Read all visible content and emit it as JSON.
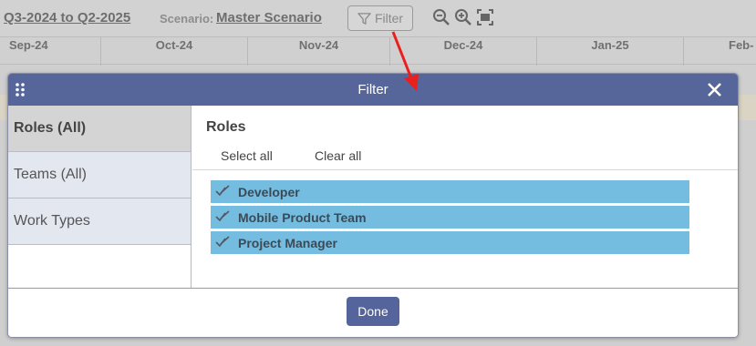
{
  "toolbar": {
    "period": "Q3-2024 to Q2-2025",
    "scenario_label": "Scenario:",
    "scenario_value": "Master Scenario",
    "filter_label": "Filter",
    "icons": [
      "filter-icon",
      "zoom-out-icon",
      "zoom-in-icon",
      "fit-screen-icon"
    ]
  },
  "timeline": {
    "months": [
      "Sep-24",
      "Oct-24",
      "Nov-24",
      "Dec-24",
      "Jan-25",
      "Feb-"
    ]
  },
  "dialog": {
    "title": "Filter",
    "sidebar": [
      {
        "label": "Roles (All)",
        "active": true
      },
      {
        "label": "Teams (All)",
        "active": false
      },
      {
        "label": "Work Types",
        "active": false
      }
    ],
    "section_title": "Roles",
    "select_all": "Select all",
    "clear_all": "Clear all",
    "roles": [
      {
        "label": "Developer",
        "checked": true
      },
      {
        "label": "Mobile Product Team",
        "checked": true
      },
      {
        "label": "Project Manager",
        "checked": true
      }
    ],
    "done_label": "Done"
  },
  "colors": {
    "header": "#56669a",
    "selected_row": "#74bde0",
    "sidebar_item": "#e2e7f0",
    "sidebar_active": "#d4d4d4",
    "annotation_arrow": "#e8201e"
  }
}
